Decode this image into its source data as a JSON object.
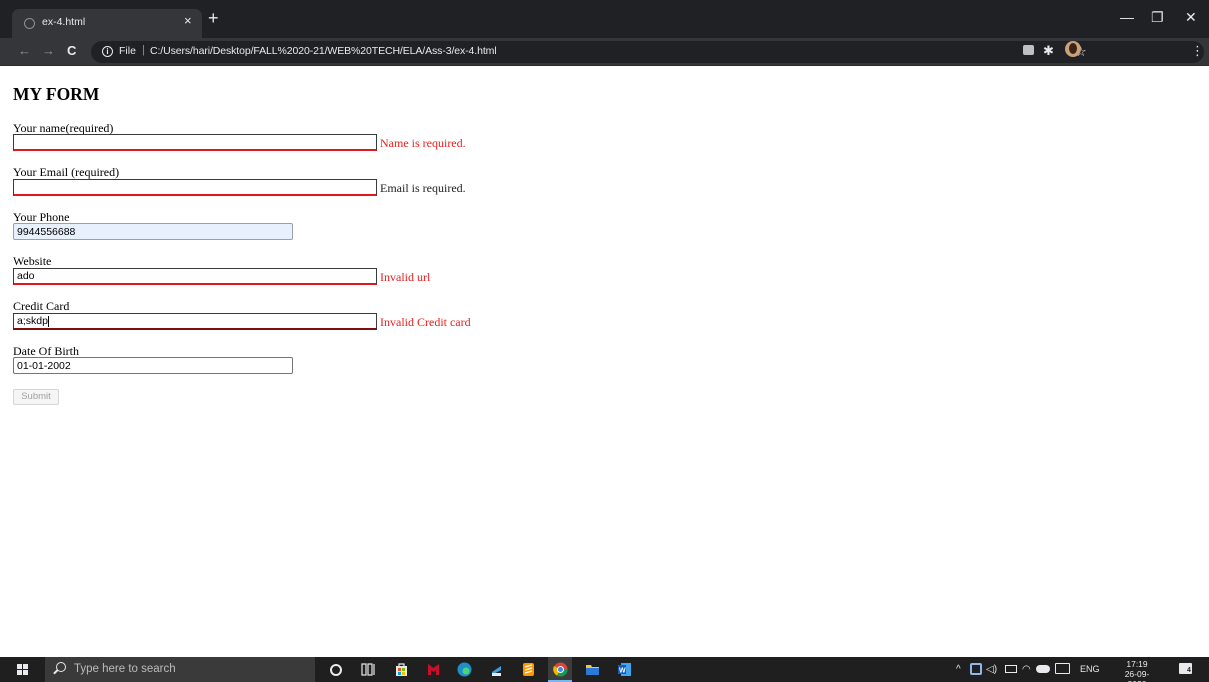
{
  "browser": {
    "tab_title": "ex-4.html",
    "tab_close": "×",
    "new_tab": "+",
    "window_controls": {
      "minimize": "—",
      "maximize": "❐",
      "close": "✕"
    },
    "nav": {
      "back": "←",
      "forward": "→",
      "reload": "C"
    },
    "address_scheme_label": "File",
    "address_separator": "|",
    "address_url": "C:/Users/hari/Desktop/FALL%2020-21/WEB%20TECH/ELA/Ass-3/ex-4.html",
    "toolbar_icons": [
      "star-icon",
      "extension-square-icon",
      "puzzle-icon",
      "profile-avatar",
      "menu-kebab-icon"
    ],
    "star": "☆",
    "puzzle": "✱",
    "menu": "⋮",
    "info": "i"
  },
  "form": {
    "title": "MY FORM",
    "fields": {
      "name": {
        "label": "Your name(required)",
        "value": "",
        "message": "Name is required."
      },
      "email": {
        "label": "Your Email (required)",
        "value": "",
        "message": "Email is required."
      },
      "phone": {
        "label": "Your Phone",
        "value": "9944556688"
      },
      "website": {
        "label": "Website",
        "value": "ado",
        "message": "Invalid url"
      },
      "credit_card": {
        "label": "Credit Card",
        "value": "a;skdp",
        "message": "Invalid Credit card"
      },
      "dob": {
        "label": "Date Of Birth",
        "value": "01-01-2002"
      }
    },
    "submit_label": "Submit",
    "colors": {
      "error": "#e8201f",
      "autofill_bg": "#e8f0fe"
    }
  },
  "taskbar": {
    "search_placeholder": "Type here to search",
    "pinned_apps": [
      "cortana-icon",
      "task-view-icon",
      "store-icon",
      "mcafee-icon",
      "edge-icon",
      "app-icon",
      "sublime-icon",
      "chrome-icon",
      "file-explorer-icon",
      "word-icon"
    ],
    "tray": {
      "chevron": "^",
      "lang": "ENG"
    },
    "time": "17:19",
    "date": "26-09-2020",
    "notification_count": "4"
  }
}
